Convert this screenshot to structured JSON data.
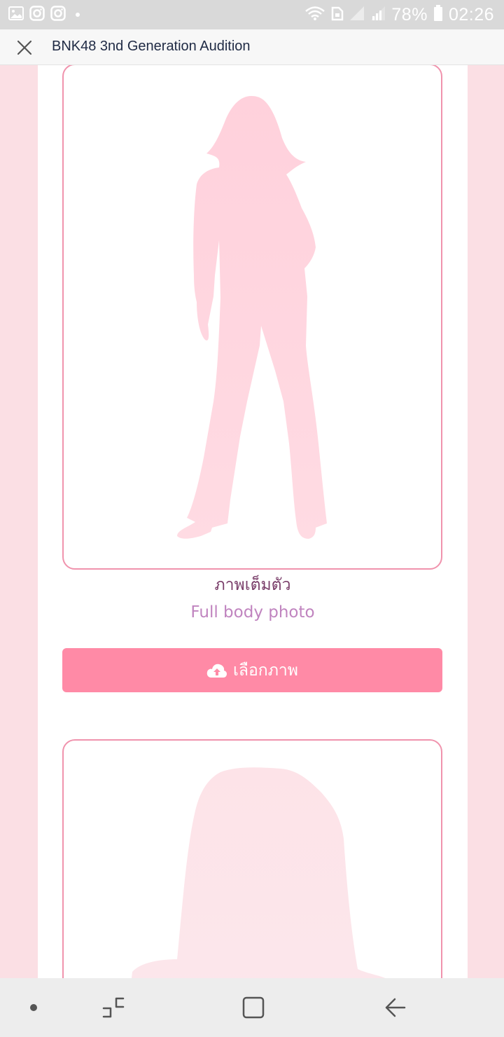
{
  "status_bar": {
    "battery": "78%",
    "time": "02:26",
    "icons": [
      "gallery-icon",
      "instagram-icon",
      "instagram-icon",
      "wifi-icon",
      "sim-icon",
      "signal-icon",
      "signal-icon",
      "battery-icon"
    ]
  },
  "app_bar": {
    "title": "BNK48 3nd Generation Audition",
    "close_icon": "close-icon"
  },
  "photos": [
    {
      "title_th": "ภาพเต็มตัว",
      "title_en": "Full body photo",
      "button_label": "เลือกภาพ",
      "button_icon": "cloud-upload-icon"
    },
    {
      "title_th": "",
      "title_en": ""
    }
  ],
  "colors": {
    "status_bar": "#d9d9d9",
    "page_background": "#fbdfe4",
    "card_border": "#f093ad",
    "button": "#ff8aa6",
    "title_th": "#7a3e6a",
    "title_en": "#c084bf",
    "silhouette": "#ffd6df"
  },
  "nav_bar": {
    "items": [
      "dot-icon",
      "recent-apps-icon",
      "home-icon",
      "back-icon"
    ]
  }
}
